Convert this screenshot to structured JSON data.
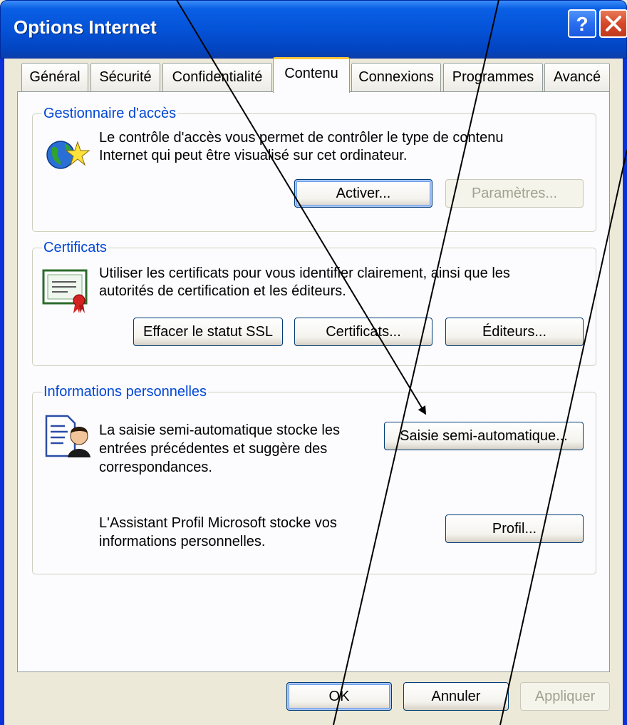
{
  "window": {
    "title": "Options Internet"
  },
  "tabs": [
    {
      "label": "Général"
    },
    {
      "label": "Sécurité"
    },
    {
      "label": "Confidentialité"
    },
    {
      "label": "Contenu"
    },
    {
      "label": "Connexions"
    },
    {
      "label": "Programmes"
    },
    {
      "label": "Avancé"
    }
  ],
  "active_tab": "Contenu",
  "access_group": {
    "title": "Gestionnaire d'accès",
    "line1": "Le contrôle d'accès vous permet de contrôler le type de contenu",
    "line2": "Internet qui peut être visualisé sur cet ordinateur.",
    "enable_label": "Activer...",
    "settings_label": "Paramètres..."
  },
  "cert_group": {
    "title": "Certificats",
    "line1": "Utiliser les certificats pour vous identifier clairement, ainsi que les",
    "line2": "autorités de certification et les éditeurs.",
    "clear_ssl_label": "Effacer le statut SSL",
    "certificates_label": "Certificats...",
    "publishers_label": "Éditeurs..."
  },
  "personal_group": {
    "title": "Informations personnelles",
    "autocomplete_line1": "La saisie semi-automatique stocke les",
    "autocomplete_line2": "entrées précédentes et suggère des",
    "autocomplete_line3": "correspondances.",
    "autocomplete_label": "Saisie semi-automatique...",
    "profile_line1": "L'Assistant Profil Microsoft stocke vos",
    "profile_line2": "informations personnelles.",
    "profile_label": "Profil..."
  },
  "footer": {
    "ok_label": "OK",
    "cancel_label": "Annuler",
    "apply_label": "Appliquer"
  },
  "colors": {
    "group_title": "#0046d5",
    "active_tab_accent": "#ffc83c",
    "titlebar": "#0453d8"
  },
  "icons": {
    "help": "question-mark-icon",
    "close": "close-x-icon",
    "access": "globe-star-icon",
    "certificate": "certificate-ribbon-icon",
    "autocomplete": "document-person-icon"
  }
}
